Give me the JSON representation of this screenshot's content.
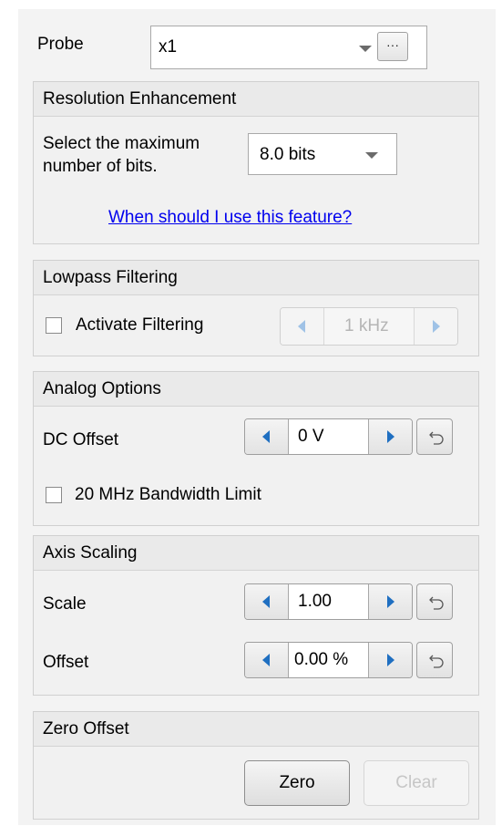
{
  "probe": {
    "label": "Probe",
    "selected": "x1",
    "more_button_label": "···"
  },
  "resolution": {
    "title": "Resolution Enhancement",
    "description_line1": "Select the maximum",
    "description_line2": "number of bits.",
    "selected": "8.0 bits",
    "help_link": "When should I use this feature?"
  },
  "lowpass": {
    "title": "Lowpass Filtering",
    "checkbox_label": "Activate Filtering",
    "checked": false,
    "frequency": "1 kHz",
    "enabled": false
  },
  "analog": {
    "title": "Analog Options",
    "dc_offset_label": "DC Offset",
    "dc_offset_value": "0 V",
    "bandwidth_label": "20 MHz Bandwidth Limit",
    "bandwidth_checked": false
  },
  "axis": {
    "title": "Axis Scaling",
    "scale_label": "Scale",
    "scale_value": "1.00",
    "offset_label": "Offset",
    "offset_value": "0.00 %"
  },
  "zero_offset": {
    "title": "Zero Offset",
    "zero_button": "Zero",
    "clear_button": "Clear"
  },
  "colors": {
    "arrow_accent": "#1f6fc1",
    "link": "#0000ee",
    "disabled_text": "#b5b5b5"
  },
  "icons": {
    "spinner_decrement": "triangle-left-icon",
    "spinner_increment": "triangle-right-icon",
    "reset": "undo-arrow-icon",
    "dropdown": "chevron-down-icon"
  }
}
